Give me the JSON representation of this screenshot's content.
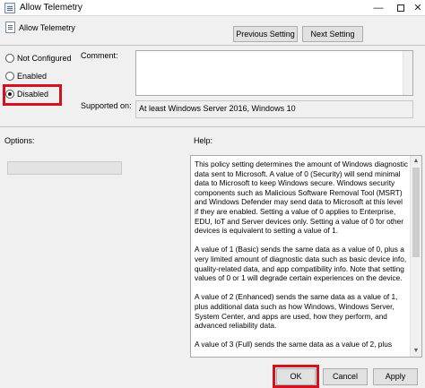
{
  "window": {
    "title": "Allow Telemetry"
  },
  "window_controls": {
    "minimize": "—",
    "close": "✕"
  },
  "header": {
    "policy_name": "Allow Telemetry",
    "previous_label": "Previous Setting",
    "next_label": "Next Setting"
  },
  "state": {
    "options": [
      {
        "label": "Not Configured",
        "checked": false
      },
      {
        "label": "Enabled",
        "checked": false
      },
      {
        "label": "Disabled",
        "checked": true
      }
    ]
  },
  "comment": {
    "label": "Comment:",
    "value": ""
  },
  "supported": {
    "label": "Supported on:",
    "value": "At least Windows Server 2016, Windows 10"
  },
  "options_label": "Options:",
  "help_label": "Help:",
  "help_paragraphs": [
    "This policy setting determines the amount of Windows diagnostic data sent to Microsoft. A value of 0 (Security) will send minimal data to Microsoft to keep Windows secure. Windows security components such as Malicious Software Removal Tool (MSRT) and Windows Defender may send data to Microsoft at this level if they are enabled. Setting a value of 0 applies to Enterprise, EDU, IoT and Server devices only. Setting a value of 0 for other devices is equivalent to setting a value of 1.",
    "A value of 1 (Basic) sends the same data as a value of 0, plus a very limited amount of diagnostic data such as basic device info, quality-related data, and app compatibility info. Note that setting values of 0 or 1 will degrade certain experiences on the device.",
    "A value of 2 (Enhanced) sends the same data as a value of 1, plus additional data such as how Windows, Windows Server, System Center, and apps are used, how they perform, and advanced reliability data.",
    "A value of 3 (Full) sends the same data as a value of 2, plus"
  ],
  "footer": {
    "ok_label": "OK",
    "cancel_label": "Cancel",
    "apply_label": "Apply"
  },
  "colors": {
    "highlight": "#d4121e",
    "background": "#f0f0f0"
  }
}
